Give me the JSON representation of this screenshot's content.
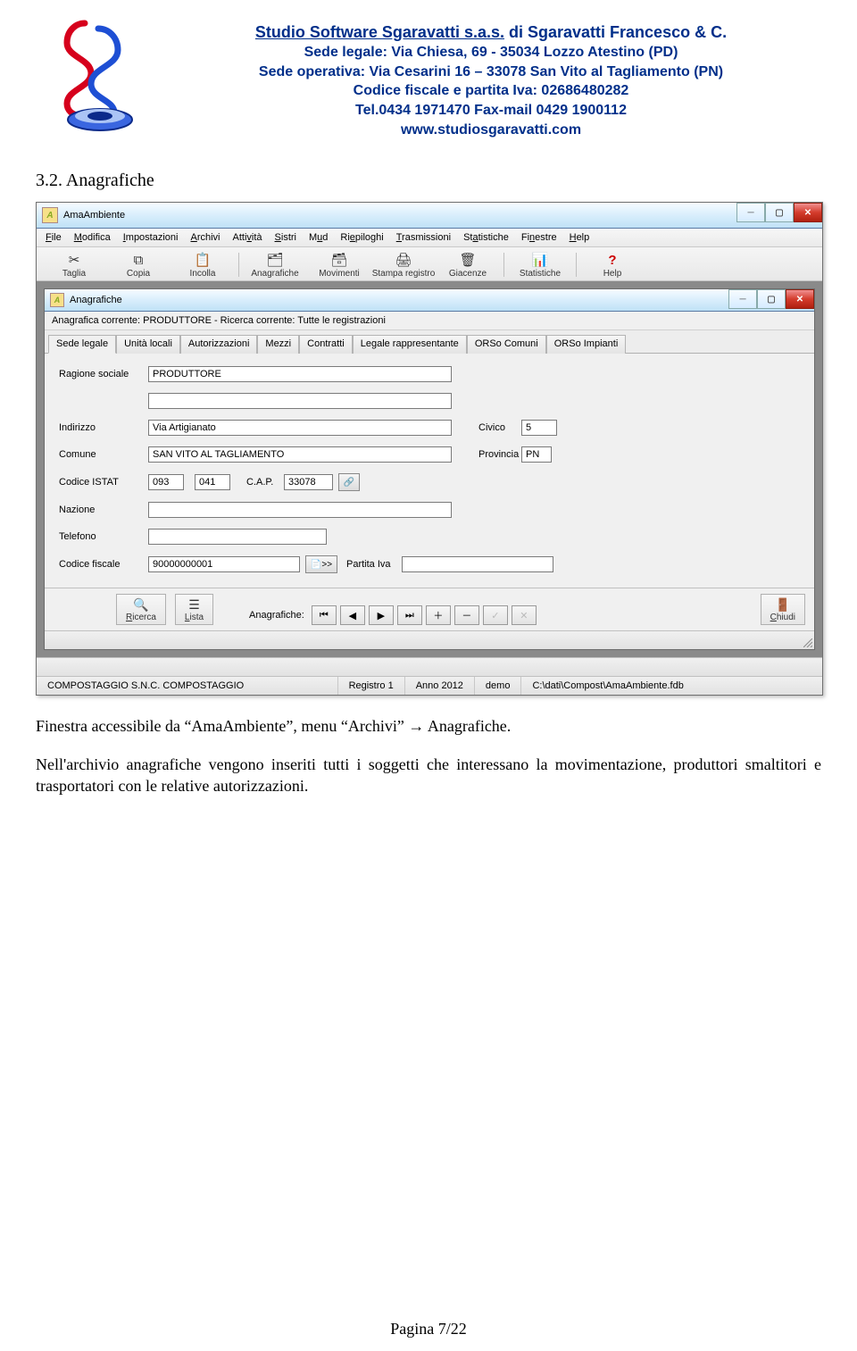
{
  "letterhead": {
    "line1_prefix": "Studio Software Sgaravatti s.a.s.",
    "line1_suffix": " di Sgaravatti Francesco & C.",
    "line2": "Sede legale: Via Chiesa, 69 - 35034 Lozzo Atestino (PD)",
    "line3": "Sede operativa: Via Cesarini 16 – 33078 San Vito al Tagliamento (PN)",
    "line4": "Codice fiscale e partita Iva: 02686480282",
    "line5": "Tel.0434 1971470 Fax-mail 0429 1900112",
    "line6": "www.studiosgaravatti.com"
  },
  "section_title": "3.2. Anagrafiche",
  "app": {
    "title": "AmaAmbiente",
    "menus": [
      "File",
      "Modifica",
      "Impostazioni",
      "Archivi",
      "Attività",
      "Sistri",
      "Mud",
      "Riepiloghi",
      "Trasmissioni",
      "Statistiche",
      "Finestre",
      "Help"
    ],
    "toolbar": [
      {
        "icon": "✂",
        "label": "Taglia"
      },
      {
        "icon": "⧉",
        "label": "Copia"
      },
      {
        "icon": "📋",
        "label": "Incolla"
      },
      {
        "sep": true
      },
      {
        "icon": "🗂",
        "label": "Anagrafiche"
      },
      {
        "icon": "🗃",
        "label": "Movimenti"
      },
      {
        "icon": "🖨",
        "label": "Stampa registro"
      },
      {
        "icon": "🗑",
        "label": "Giacenze"
      },
      {
        "sep": true
      },
      {
        "icon": "📊",
        "label": "Statistiche"
      },
      {
        "sep": true
      },
      {
        "icon": "?",
        "label": "Help"
      }
    ],
    "inner_title": "Anagrafiche",
    "crumb": "Anagrafica corrente: PRODUTTORE - Ricerca corrente: Tutte le registrazioni",
    "tabs": [
      "Sede legale",
      "Unità locali",
      "Autorizzazioni",
      "Mezzi",
      "Contratti",
      "Legale rappresentante",
      "ORSo Comuni",
      "ORSo Impianti"
    ],
    "form": {
      "ragione_sociale_label": "Ragione sociale",
      "ragione_sociale": "PRODUTTORE",
      "indirizzo_label": "Indirizzo",
      "indirizzo": "Via Artigianato",
      "civico_label": "Civico",
      "civico": "5",
      "comune_label": "Comune",
      "comune": "SAN VITO AL TAGLIAMENTO",
      "provincia_label": "Provincia",
      "provincia": "PN",
      "istat_label": "Codice ISTAT",
      "istat1": "093",
      "istat2": "041",
      "cap_label": "C.A.P.",
      "cap": "33078",
      "nazione_label": "Nazione",
      "nazione": "",
      "telefono_label": "Telefono",
      "telefono": "",
      "cf_label": "Codice fiscale",
      "cf": "90000000001",
      "copy_label": ">>",
      "pi_label": "Partita Iva",
      "pi": ""
    },
    "innerbar": {
      "ricerca": "Ricerca",
      "lista": "Lista",
      "anagrafiche_lbl": "Anagrafiche:",
      "chiudi": "Chiudi"
    },
    "status": {
      "c1": "COMPOSTAGGIO  S.N.C. COMPOSTAGGIO",
      "c2": "Registro 1",
      "c3": "Anno 2012",
      "c4": "demo",
      "c5": "C:\\dati\\Compost\\AmaAmbiente.fdb"
    }
  },
  "bodytext": {
    "p1": "Finestra accessibile da “AmaAmbiente”,  menu “Archivi” → Anagrafiche.",
    "p2": "Nell'archivio anagrafiche vengono inseriti tutti i soggetti che interessano la movimentazione, produttori smaltitori e trasportatori con le relative autorizzazioni."
  },
  "footer": "Pagina 7/22"
}
